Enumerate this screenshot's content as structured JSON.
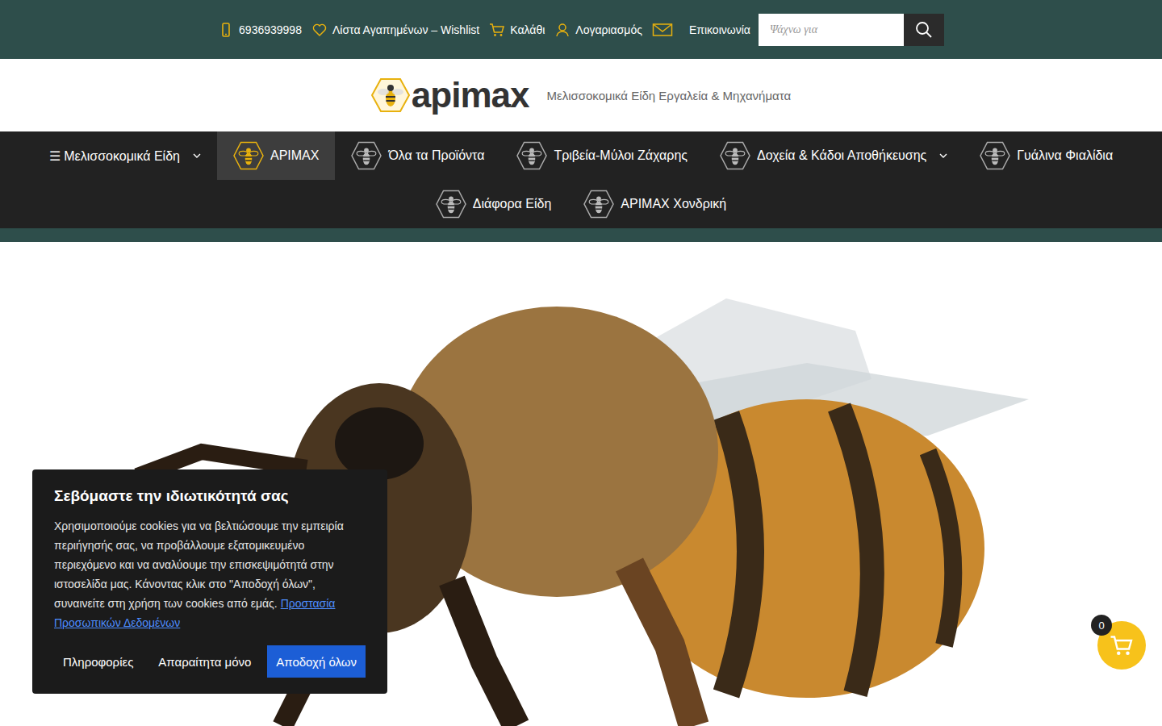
{
  "topbar": {
    "links": [
      {
        "kind": "phone",
        "label": "6936939998"
      },
      {
        "kind": "wishlist",
        "label": "Λίστα Αγαπημένων – Wishlist"
      },
      {
        "kind": "cart",
        "label": "Καλάθι"
      },
      {
        "kind": "account",
        "label": "Λογαριασμός"
      },
      {
        "kind": "contact",
        "label": "Επικοινωνία"
      }
    ]
  },
  "search": {
    "placeholder": "Ψάχνω για"
  },
  "logo": {
    "text": "apimax",
    "tagline": "Μελισσοκομικά Είδη Εργαλεία & Μηχανήματα"
  },
  "nav": [
    {
      "kind": "menu",
      "label": "☰ Μελισσοκομικά Είδη",
      "dropdown": true,
      "selected": false
    },
    {
      "kind": "category",
      "label": "APIMAX",
      "dropdown": false,
      "selected": true
    },
    {
      "kind": "category",
      "label": "Όλα τα Προϊόντα",
      "dropdown": false,
      "selected": false
    },
    {
      "kind": "category",
      "label": "Τριβεία-Μύλοι Ζάχαρης",
      "dropdown": false,
      "selected": false
    },
    {
      "kind": "category",
      "label": "Δοχεία & Κάδοι Αποθήκευσης",
      "dropdown": true,
      "selected": false
    },
    {
      "kind": "category",
      "label": "Γυάλινα Φιαλίδια",
      "dropdown": false,
      "selected": false
    },
    {
      "kind": "category",
      "label": "Διάφορα Είδη",
      "dropdown": false,
      "selected": false
    },
    {
      "kind": "category",
      "label": "APIMAX Χονδρική",
      "dropdown": false,
      "selected": false
    }
  ],
  "cookie": {
    "title": "Σεβόμαστε την ιδιωτικότητά σας",
    "text": "Χρησιμοποιούμε cookies για να βελτιώσουμε την εμπειρία περιήγησής σας, να προβάλλουμε εξατομικευμένο περιεχόμενο και να αναλύουμε την επισκεψιμότητά στην ιστοσελίδα μας. Κάνοντας κλικ στο \"Αποδοχή όλων\", συναινείτε στη χρήση των cookies από εμάς.",
    "link": "Προστασία Προσωπικών Δεδομένων",
    "buttons": [
      {
        "kind": "plain",
        "label": "Πληροφορίες"
      },
      {
        "kind": "plain",
        "label": "Απαραίτητα μόνο"
      },
      {
        "kind": "primary",
        "label": "Αποδοχή όλων"
      }
    ]
  },
  "cart": {
    "count": "0"
  }
}
